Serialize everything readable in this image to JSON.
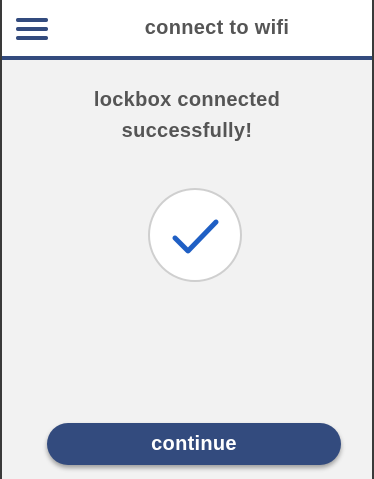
{
  "header": {
    "title": "connect to wifi",
    "menu_icon": "hamburger-menu-icon"
  },
  "main": {
    "message_line1": "lockbox connected",
    "message_line2": "successfully!",
    "status_icon": "checkmark-icon"
  },
  "footer": {
    "continue_label": "continue"
  },
  "colors": {
    "accent": "#334b7e",
    "check": "#1f5fc4",
    "text": "#555555",
    "background": "#f2f2f2"
  }
}
